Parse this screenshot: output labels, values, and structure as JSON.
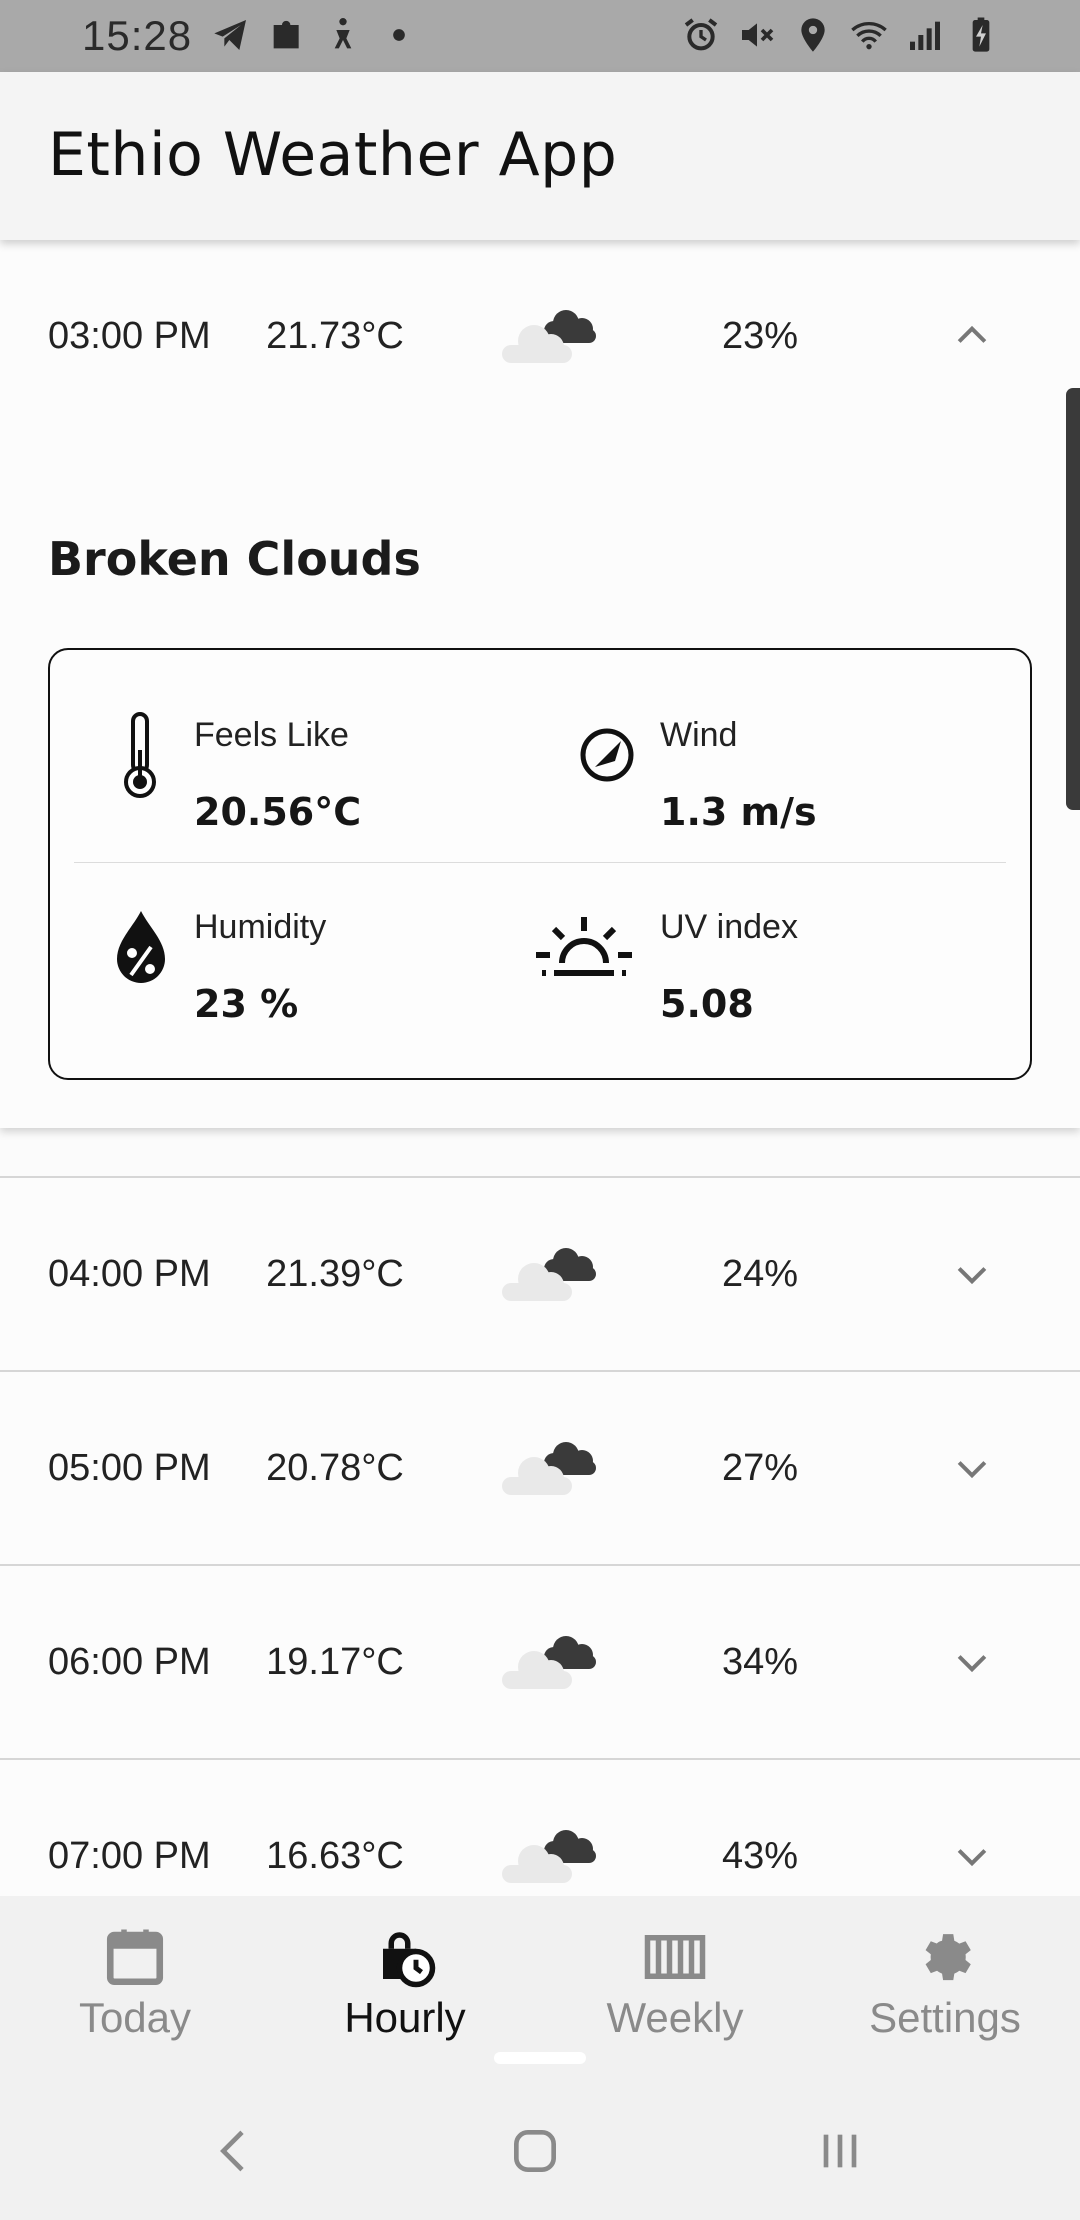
{
  "status_bar": {
    "time": "15:28",
    "left_icons": [
      "telegram-icon",
      "puzzle-icon",
      "accessibility-icon",
      "dot-icon"
    ],
    "right_icons": [
      "alarm-icon",
      "mute-icon",
      "location-icon",
      "wifi-icon",
      "signal-icon",
      "battery-charging-icon"
    ]
  },
  "app_bar": {
    "title": "Ethio Weather App"
  },
  "expanded": {
    "time": "03:00 PM",
    "temp": "21.73°C",
    "icon": "broken-clouds-icon",
    "humidity": "23%",
    "description": "Broken Clouds",
    "details": {
      "feels_like": {
        "label": "Feels Like",
        "value": "20.56°C"
      },
      "wind": {
        "label": "Wind",
        "value": "1.3 m/s"
      },
      "humidity": {
        "label": "Humidity",
        "value": "23 %"
      },
      "uv": {
        "label": "UV index",
        "value": "5.08"
      }
    }
  },
  "hours": [
    {
      "time": "04:00 PM",
      "temp": "21.39°C",
      "humidity": "24%",
      "icon": "broken-clouds-icon"
    },
    {
      "time": "05:00 PM",
      "temp": "20.78°C",
      "humidity": "27%",
      "icon": "broken-clouds-icon"
    },
    {
      "time": "06:00 PM",
      "temp": "19.17°C",
      "humidity": "34%",
      "icon": "broken-clouds-icon"
    },
    {
      "time": "07:00 PM",
      "temp": "16.63°C",
      "humidity": "43%",
      "icon": "broken-clouds-icon"
    }
  ],
  "bottom_nav": {
    "today": "Today",
    "hourly": "Hourly",
    "weekly": "Weekly",
    "settings": "Settings",
    "active": "Hourly"
  },
  "colors": {
    "status_bar": "#a9a9a9",
    "app_bar": "#f4f4f4",
    "nav_bg": "#f1f1f1",
    "active_label": "#111111",
    "inactive_label": "#8a8a8a"
  }
}
